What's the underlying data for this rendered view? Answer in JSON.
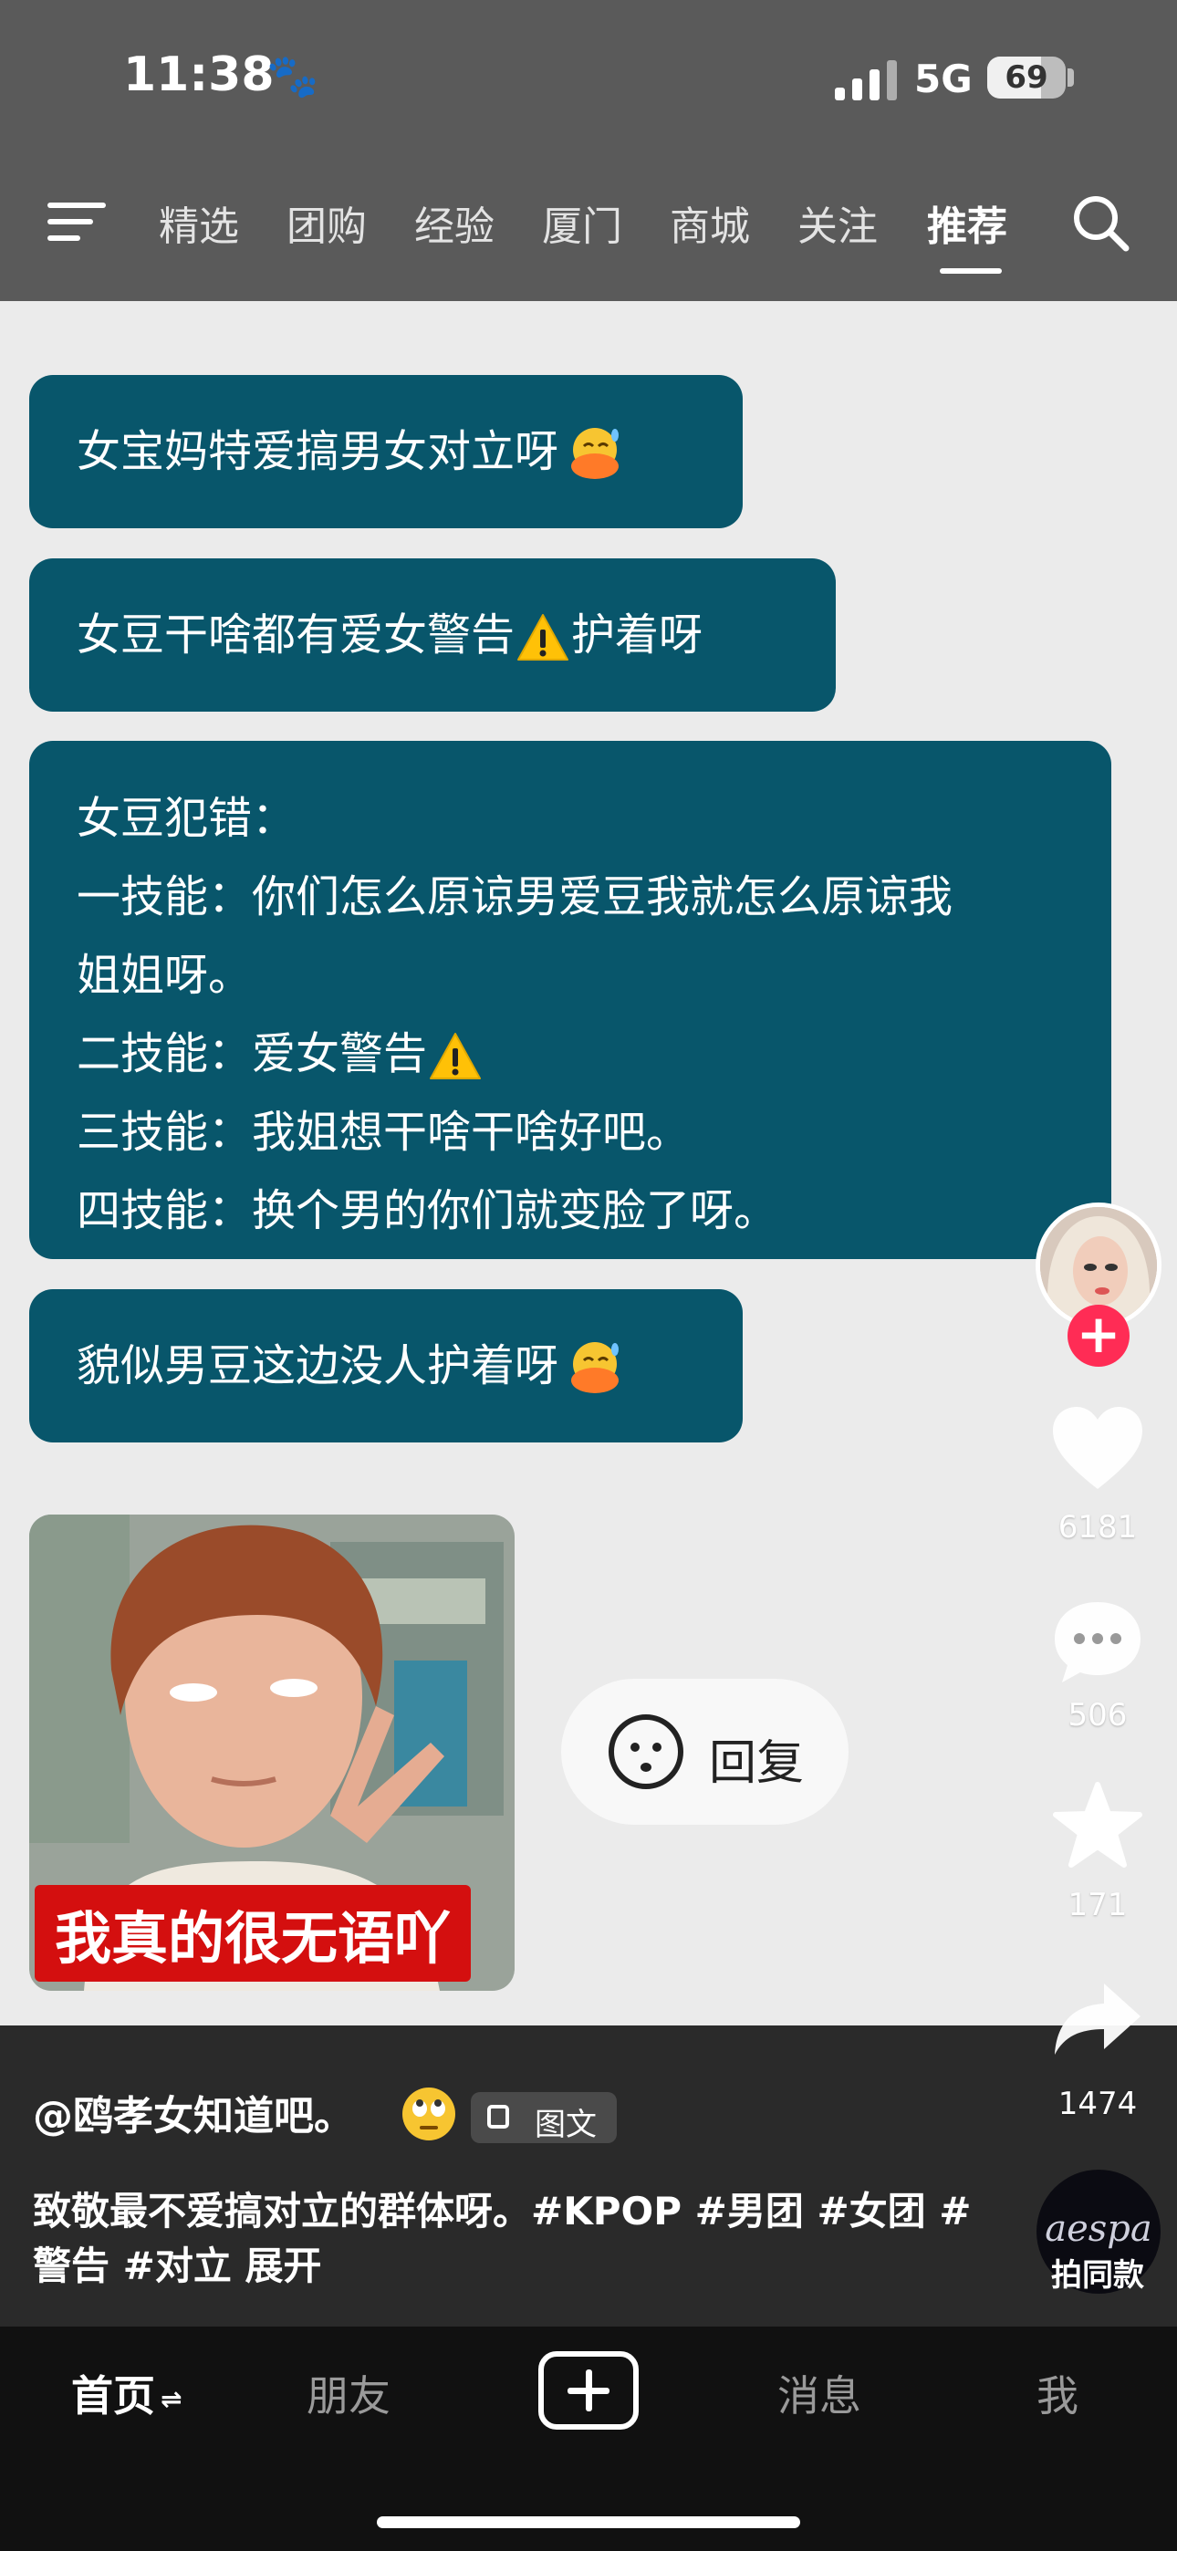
{
  "status_bar": {
    "time": "11:38",
    "network": "5G",
    "battery": "69",
    "battery_level": 0.69
  },
  "nav": {
    "tabs": [
      "精选",
      "团购",
      "经验",
      "厦门",
      "商城",
      "关注",
      "推荐"
    ],
    "active": "推荐"
  },
  "chat": {
    "messages": [
      {
        "text": "女宝妈特爱搞男女对立呀",
        "emoji": "duck-face"
      },
      {
        "text_before": "女豆干啥都有爱女警告",
        "text_after": "护着呀",
        "emoji": "warning"
      },
      {
        "lines": [
          "女豆犯错：",
          "一技能：你们怎么原谅男爱豆我就怎么原谅我",
          "姐姐呀。",
          "二技能：爱女警告",
          "三技能：我姐想干啥干啥好吧。",
          "四技能：换个男的你们就变脸了呀。"
        ]
      },
      {
        "text": "貌似男豆这边没人护着呀",
        "emoji": "duck-face"
      }
    ],
    "sticker_caption": "我真的很无语吖",
    "reply_label": "回复"
  },
  "side": {
    "likes": "6181",
    "comments": "506",
    "favorites": "171",
    "shares": "1474",
    "camera_same": "拍同款",
    "music_logo": "aespa"
  },
  "post": {
    "author": "@鸥孝女知道吧。",
    "tag": "图文",
    "description": "致敬最不爱搞对立的群体呀。#KPOP #男团 #女团 #警告 #对立",
    "expand": "展开"
  },
  "bottom_nav": {
    "home": "首页",
    "home_suffix": "⇌",
    "friends": "朋友",
    "messages": "消息",
    "me": "我"
  }
}
